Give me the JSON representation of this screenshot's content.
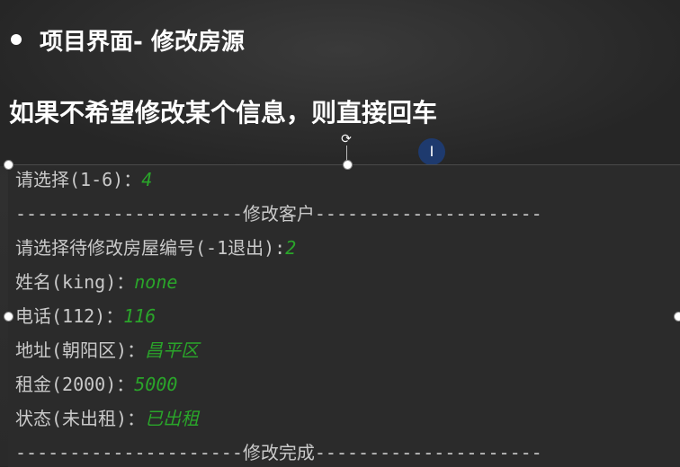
{
  "slide": {
    "title": "项目界面- 修改房源",
    "subtitle": "如果不希望修改某个信息，则直接回车"
  },
  "terminal": {
    "lines": [
      {
        "prompt": "请选择(1-6)：",
        "input": "4"
      },
      {
        "prompt": "---------------------修改客户---------------------",
        "input": ""
      },
      {
        "prompt": "请选择待修改房屋编号(-1退出):",
        "input": "2"
      },
      {
        "prompt": "姓名(king)：",
        "input": "none"
      },
      {
        "prompt": "电话(112)：",
        "input": "116"
      },
      {
        "prompt": "地址(朝阳区)：",
        "input": "昌平区"
      },
      {
        "prompt": "租金(2000)：",
        "input": "5000"
      },
      {
        "prompt": "状态(未出租)：",
        "input": "已出租"
      },
      {
        "prompt": "---------------------修改完成---------------------",
        "input": ""
      }
    ],
    "input_color": "#2aa52a"
  },
  "cursor": {
    "glyph": "I"
  },
  "rotate": {
    "glyph": "⟳"
  }
}
